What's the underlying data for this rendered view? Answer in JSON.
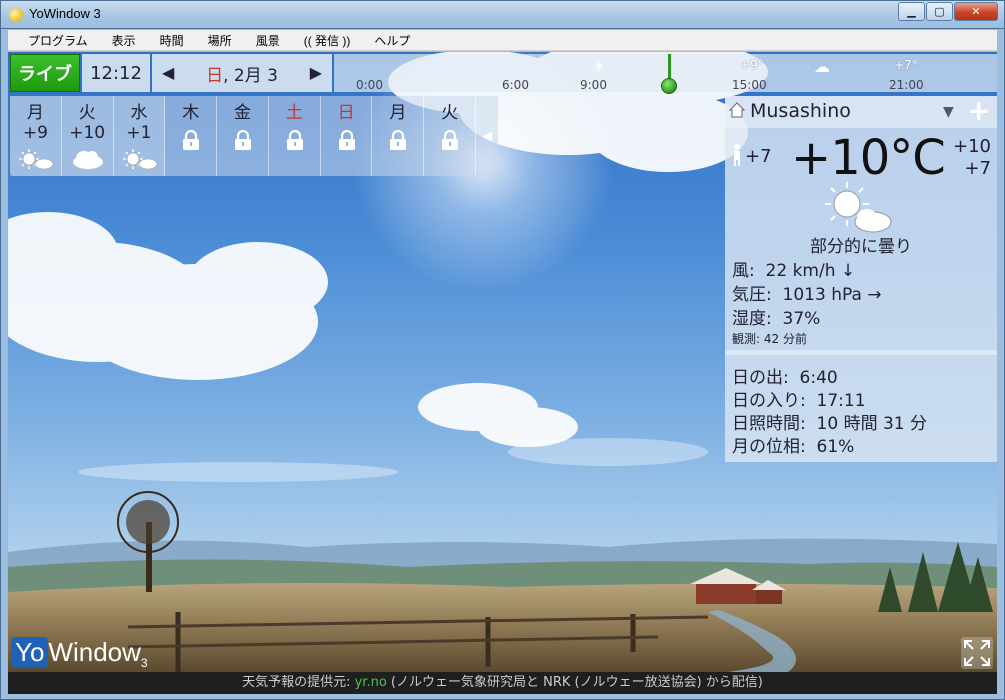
{
  "window": {
    "title": "YoWindow 3"
  },
  "menu": [
    "プログラム",
    "表示",
    "時間",
    "場所",
    "風景",
    "(( 発信 ))",
    "ヘルプ"
  ],
  "topbar": {
    "live_label": "ライブ",
    "time": "12:12",
    "date_dow": "日",
    "date_rest": ", 2月 3",
    "timeline_labels": [
      {
        "label": "0:00"
      },
      {
        "label": "6:00"
      },
      {
        "label": "9:00"
      },
      {
        "label": "15:00"
      },
      {
        "label": "21:00"
      }
    ],
    "timeline_temps": [
      "+9°",
      "+7°"
    ]
  },
  "days": [
    {
      "name": "月",
      "temp": "+9",
      "icon": "partly-cloudy-icon",
      "locked": false,
      "red": false
    },
    {
      "name": "火",
      "temp": "+10",
      "icon": "cloud-icon",
      "locked": false,
      "red": false
    },
    {
      "name": "水",
      "temp": "+1",
      "icon": "partly-cloudy-icon",
      "locked": false,
      "red": false
    },
    {
      "name": "木",
      "temp": "",
      "icon": "lock-icon",
      "locked": true,
      "red": false
    },
    {
      "name": "金",
      "temp": "",
      "icon": "lock-icon",
      "locked": true,
      "red": false
    },
    {
      "name": "土",
      "temp": "",
      "icon": "lock-icon",
      "locked": true,
      "red": true
    },
    {
      "name": "日",
      "temp": "",
      "icon": "lock-icon",
      "locked": true,
      "red": true
    },
    {
      "name": "月",
      "temp": "",
      "icon": "lock-icon",
      "locked": true,
      "red": false
    },
    {
      "name": "火",
      "temp": "",
      "icon": "lock-icon",
      "locked": true,
      "red": false
    }
  ],
  "location": {
    "name": "Musashino"
  },
  "now": {
    "feels_like": "+7",
    "temperature": "+10°C",
    "high": "+10",
    "low": "+7",
    "condition": "部分的に曇り",
    "wind_label": "風:",
    "wind_value": "22 km/h ↓",
    "pressure_label": "気圧:",
    "pressure_value": "1013 hPa →",
    "humidity_label": "湿度:",
    "humidity_value": "37%",
    "observed": "観測:  42 分前"
  },
  "sun": {
    "sunrise_label": "日の出:",
    "sunrise_value": "6:40",
    "sunset_label": "日の入り:",
    "sunset_value": "17:11",
    "daylight_label": "日照時間:",
    "daylight_value": "10 時間 31 分",
    "moon_label": "月の位相:",
    "moon_value": "61%"
  },
  "logo": {
    "yo": "Yo",
    "rest": "Window",
    "version": "3"
  },
  "footer": {
    "prefix": "天気予報の提供元: ",
    "link": "yr.no",
    "suffix": " (ノルウェー気象研究局と NRK (ノルウェー放送協会) から配信)"
  }
}
